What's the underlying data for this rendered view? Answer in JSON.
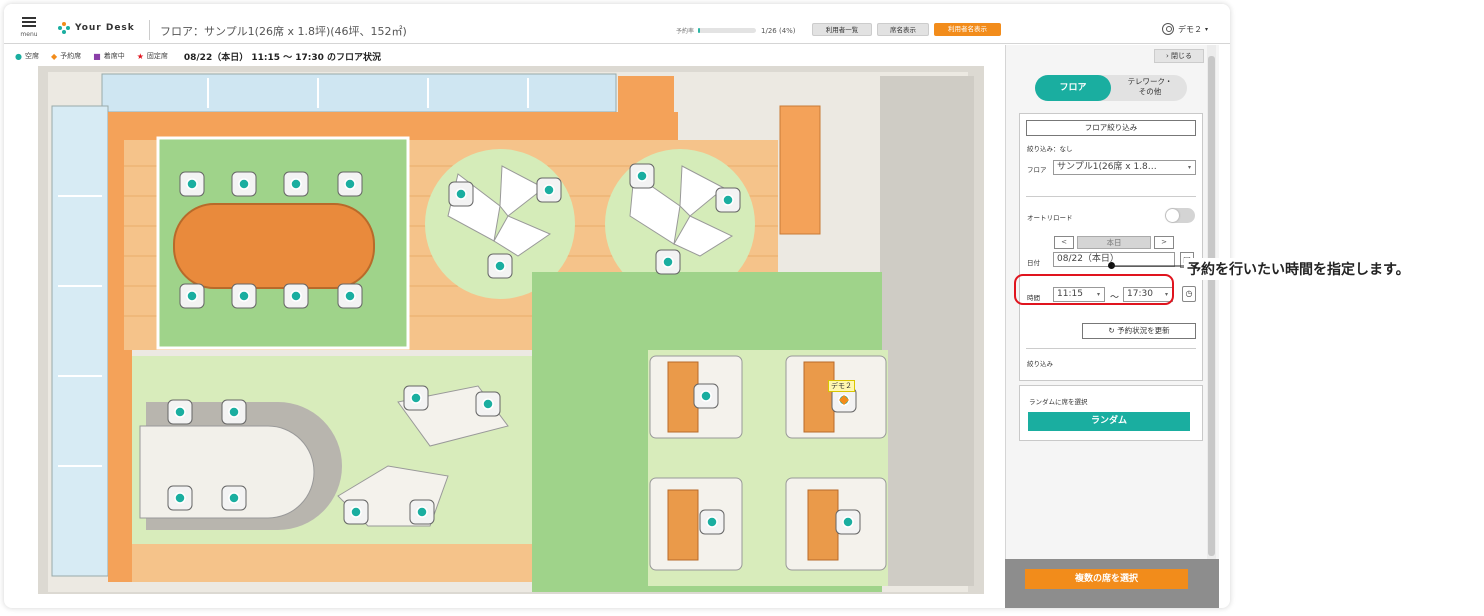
{
  "header": {
    "menu_label": "menu",
    "logo_text": "Your Desk",
    "floor_title": "フロア：サンプル1(26席 x 1.8坪)(46坪、152㎡)",
    "occupancy_label": "予約率",
    "occupancy_value": "1/26 (4%)",
    "occupancy_fraction": 0.04,
    "buttons": {
      "user_list": "利用者一覧",
      "seat_names": "席名表示",
      "user_names": "利用者名表示"
    },
    "user_name": "デモ２",
    "user_caret": "▾"
  },
  "status_bar": {
    "legend": [
      {
        "symbol": "●",
        "label": "空席",
        "color": "#1aaea0"
      },
      {
        "symbol": "◆",
        "label": "予約席",
        "color": "#f28c1b"
      },
      {
        "symbol": "■",
        "label": "着席中",
        "color": "#8a3fa8"
      },
      {
        "symbol": "★",
        "label": "固定席",
        "color": "#e0141e"
      }
    ],
    "situation": "08/22（本日） 11:15 〜 17:30 のフロア状況"
  },
  "map": {
    "zoom_in": "+",
    "zoom_out": "−",
    "occupied_seat_label": "デモ２"
  },
  "panel": {
    "close_label": "閉じる",
    "tabs": {
      "floor": "フロア",
      "telework_line1": "テレワーク・",
      "telework_line2": "その他"
    },
    "floor_filter_button": "フロア絞り込み",
    "filter_status": "絞り込み：なし",
    "floor_label": "フロア",
    "floor_select": "サンプル1(26席 x 1.8…",
    "auto_reload_label": "オートリロード",
    "prev_day": "<",
    "today_button": "本日",
    "next_day": ">",
    "date_label": "日付",
    "date_value": "08/22（本日）",
    "time_label": "時間",
    "start_time": "11:15",
    "tilde": "〜",
    "end_time": "17:30",
    "refresh_button": "予約状況を更新",
    "narrow_label": "絞り込み",
    "random_label": "ランダムに席を選択",
    "random_button": "ランダム",
    "multi_select_button": "複数の席を選択"
  },
  "callout": {
    "text": "予約を行いたい時間を指定します。"
  },
  "colors": {
    "accent": "#1aaea0",
    "orange": "#f28c1b",
    "highlight": "#e0141e"
  }
}
